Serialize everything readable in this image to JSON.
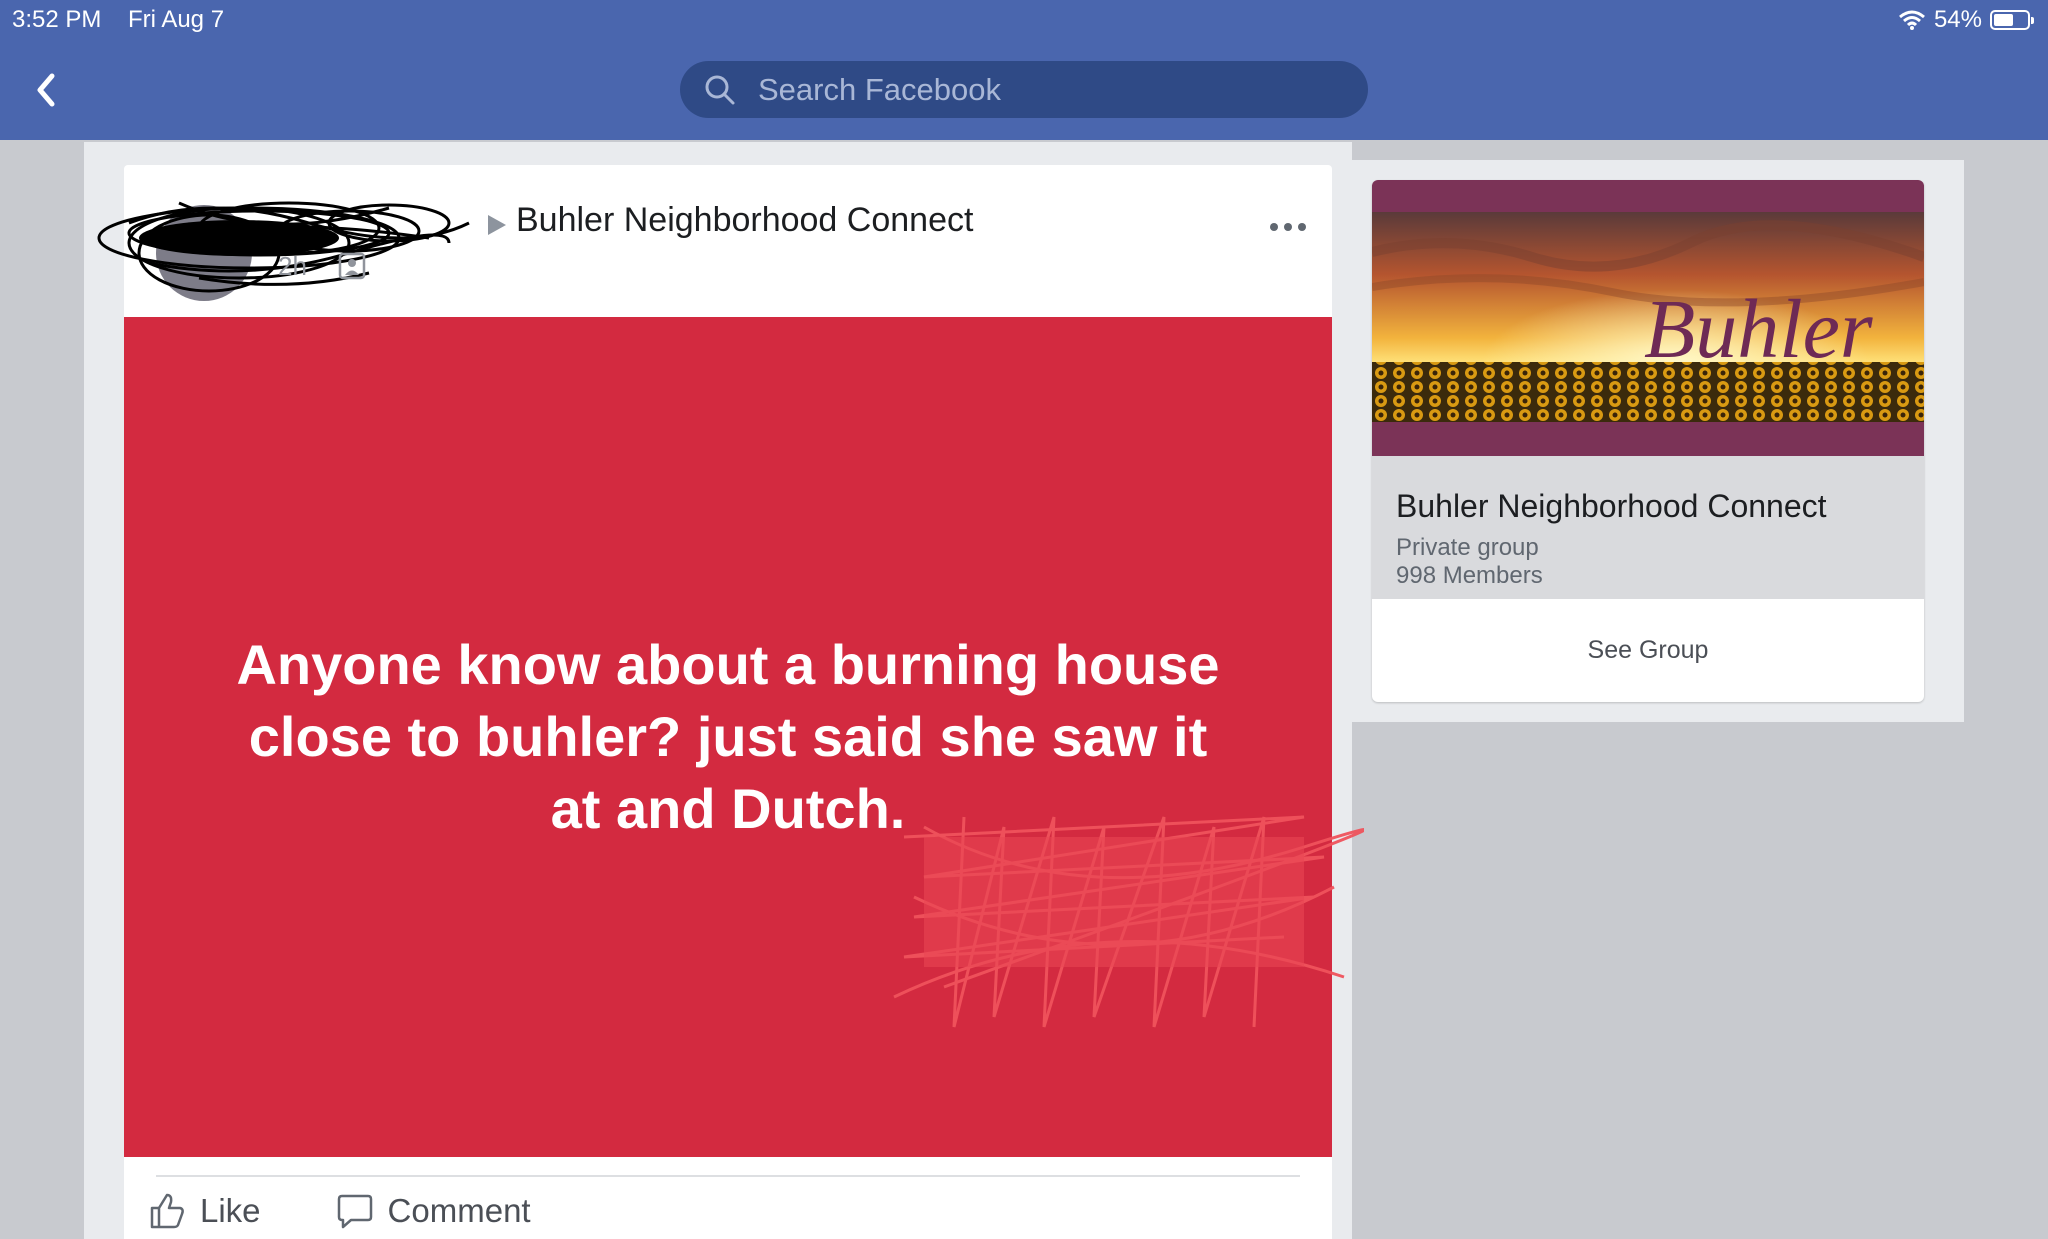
{
  "status_bar": {
    "time": "3:52 PM",
    "date": "Fri Aug 7",
    "battery": "54%",
    "battery_level": 0.54
  },
  "header": {
    "search_placeholder": "Search Facebook"
  },
  "post": {
    "time": "2h",
    "group_name": "Buhler Neighborhood Connect",
    "text": "Anyone know about a burning house close to buhler? just said she saw it at and Dutch.",
    "actions": {
      "like": "Like",
      "comment": "Comment"
    }
  },
  "group_card": {
    "banner_text": "Buhler",
    "title": "Buhler Neighborhood Connect",
    "privacy": "Private group",
    "members": "998 Members",
    "button": "See Group"
  },
  "colors": {
    "header": "#4a66ae",
    "search": "#2f4a86",
    "post_background": "#d32a40",
    "banner_frame": "#7b3357"
  },
  "icons": [
    "back-chevron-icon",
    "search-icon",
    "wifi-icon",
    "battery-icon",
    "audience-icon",
    "more-options-icon",
    "like-icon",
    "comment-icon"
  ]
}
